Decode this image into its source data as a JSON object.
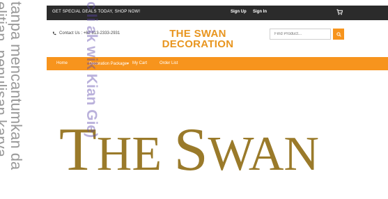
{
  "topbar": {
    "promo": "GET SPECIAL DEALS TODAY, SHOP NOW!",
    "signup": "Sign Up",
    "signin": "Sign In",
    "cart_icon": "shopping-cart-icon"
  },
  "header": {
    "contact": "Contact Us : +62 813-2333-2931",
    "phone_icon": "phone-icon",
    "brand_line1": "THE SWAN",
    "brand_line2": "DECORATION",
    "search_placeholder": "Find Product...",
    "search_icon": "search-icon"
  },
  "nav": {
    "items": [
      "Home",
      "Decoration Package",
      "My Cart",
      "Order List"
    ]
  },
  "hero": {
    "text_first": "T",
    "text_rest": "HE ",
    "text_second": "S",
    "text_second_rest": "WAN"
  },
  "watermark": {
    "left_line1": "tanpa mencantumkan da",
    "left_line2": "elitian, penulisan karya",
    "center": "c Ii ak wik Kian Gie)"
  },
  "colors": {
    "accent": "#f7941d",
    "brand": "#e8951f",
    "topbar": "#2b2b2b",
    "hero_gold": "#9a7a2a"
  }
}
